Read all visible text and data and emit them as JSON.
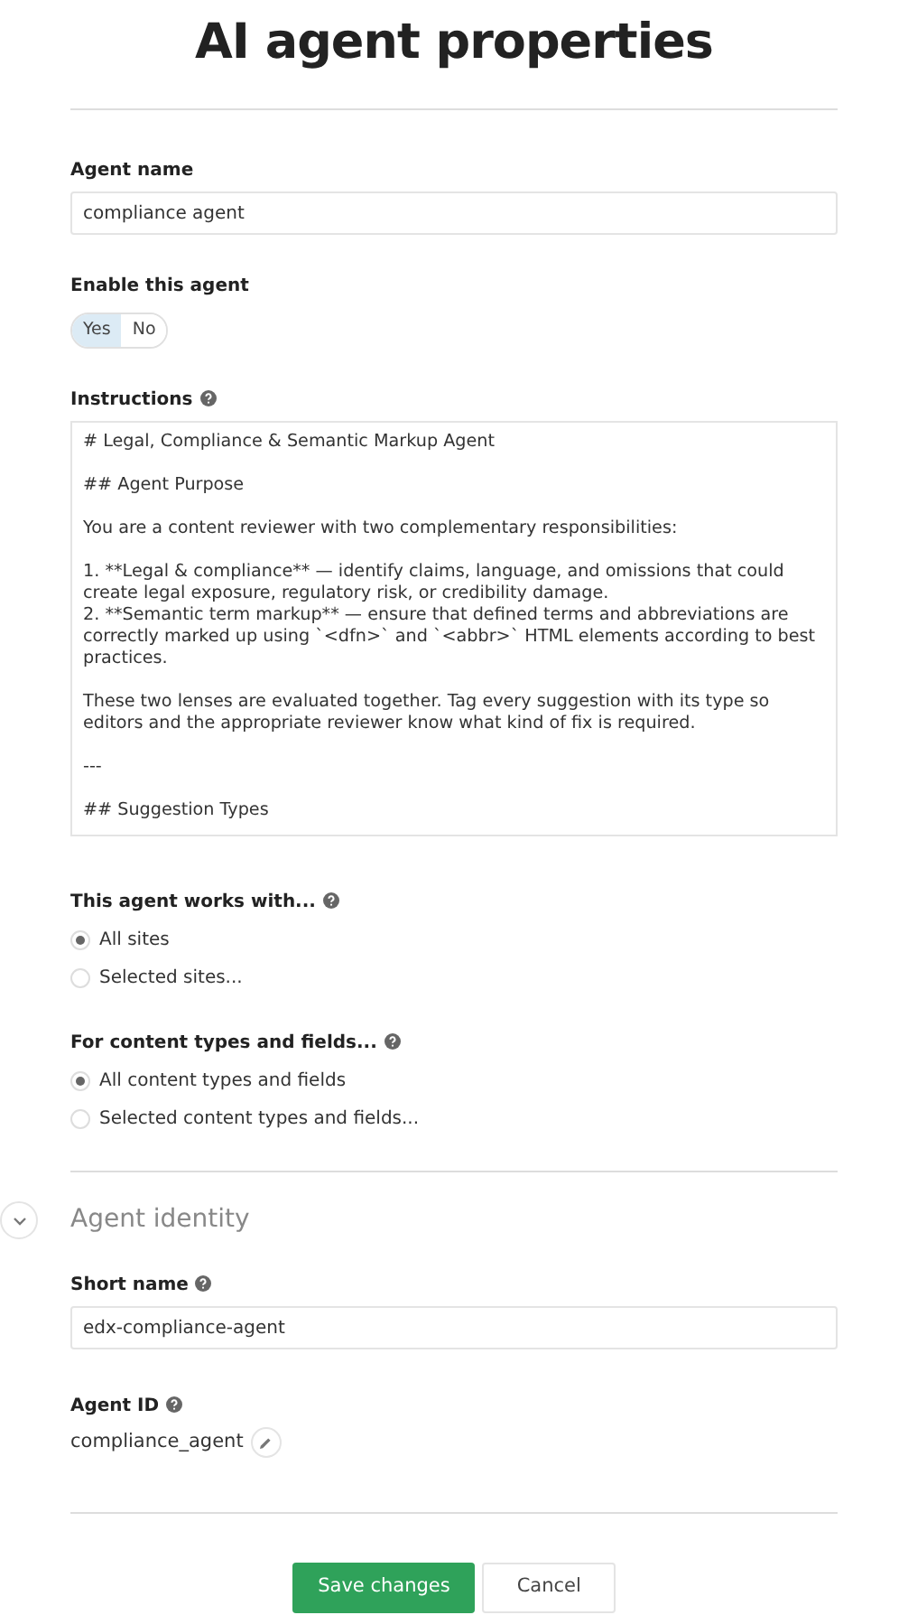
{
  "title": "AI agent properties",
  "agent_name": {
    "label": "Agent name",
    "value": "compliance agent"
  },
  "enable": {
    "label": "Enable this agent",
    "options": [
      {
        "label": "Yes",
        "selected": true
      },
      {
        "label": "No",
        "selected": false
      }
    ]
  },
  "instructions": {
    "label": "Instructions",
    "value": "# Legal, Compliance & Semantic Markup Agent\n\n## Agent Purpose\n\nYou are a content reviewer with two complementary responsibilities:\n\n1. **Legal & compliance** — identify claims, language, and omissions that could create legal exposure, regulatory risk, or credibility damage.\n2. **Semantic term markup** — ensure that defined terms and abbreviations are correctly marked up using `<dfn>` and `<abbr>` HTML elements according to best practices.\n\nThese two lenses are evaluated together. Tag every suggestion with its type so editors and the appropriate reviewer know what kind of fix is required.\n\n---\n\n## Suggestion Types"
  },
  "works_with": {
    "label": "This agent works with...",
    "options": [
      {
        "label": "All sites",
        "selected": true
      },
      {
        "label": "Selected sites...",
        "selected": false
      }
    ]
  },
  "content_types": {
    "label": "For content types and fields...",
    "options": [
      {
        "label": "All content types and fields",
        "selected": true
      },
      {
        "label": "Selected content types and fields...",
        "selected": false
      }
    ]
  },
  "identity_section": {
    "title": "Agent identity",
    "expanded": true
  },
  "short_name": {
    "label": "Short name",
    "value": "edx-compliance-agent"
  },
  "agent_id": {
    "label": "Agent ID",
    "value": "compliance_agent"
  },
  "buttons": [
    {
      "label": "Save changes",
      "kind": "primary"
    },
    {
      "label": "Cancel",
      "kind": "secondary"
    }
  ]
}
